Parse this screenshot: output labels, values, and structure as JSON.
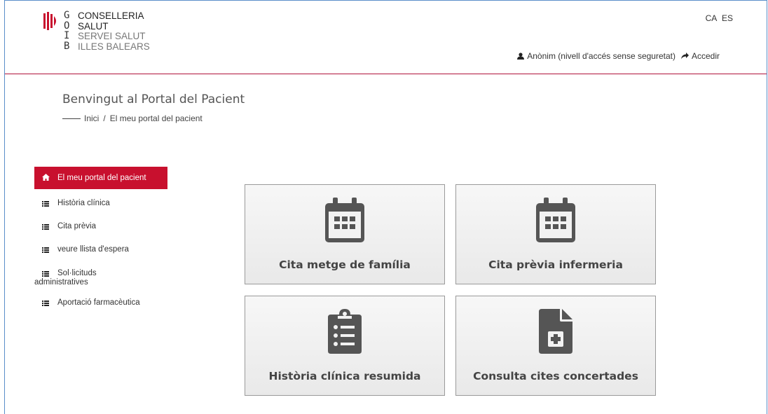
{
  "header": {
    "logo": {
      "letters": [
        "G",
        "O",
        "I",
        "B"
      ],
      "lines": [
        "CONSELLERIA",
        "SALUT",
        "SERVEI SALUT",
        "ILLES BALEARS"
      ]
    },
    "languages": [
      "CA",
      "ES"
    ],
    "user_label": "Anònim (nivell d'accés sense seguretat)",
    "login_label": "Accedir"
  },
  "page": {
    "title": "Benvingut al Portal del Pacient",
    "breadcrumb": [
      "Inici",
      "El meu portal del pacient"
    ],
    "breadcrumb_separator": "/"
  },
  "sidebar": {
    "items": [
      {
        "label": "El meu portal del pacient",
        "icon": "home-icon",
        "active": true
      },
      {
        "label": "Història clínica",
        "icon": "list-icon"
      },
      {
        "label": "Cita prèvia",
        "icon": "list-icon"
      },
      {
        "label": "veure llista d'espera",
        "icon": "list-icon"
      },
      {
        "label": "Sol·licituds administratives",
        "icon": "list-icon"
      },
      {
        "label": "Aportació farmacèutica",
        "icon": "list-icon"
      }
    ]
  },
  "tiles": [
    {
      "label": "Cita metge de família",
      "icon": "calendar-icon"
    },
    {
      "label": "Cita prèvia infermeria",
      "icon": "calendar-icon"
    },
    {
      "label": "Història clínica resumida",
      "icon": "clipboard-list-icon"
    },
    {
      "label": "Consulta cites concertades",
      "icon": "file-medical-icon"
    }
  ],
  "colors": {
    "accent": "#c8102e",
    "header_border": "#b0123b",
    "frame": "#5b8fc9",
    "tile_icon": "#555555"
  }
}
